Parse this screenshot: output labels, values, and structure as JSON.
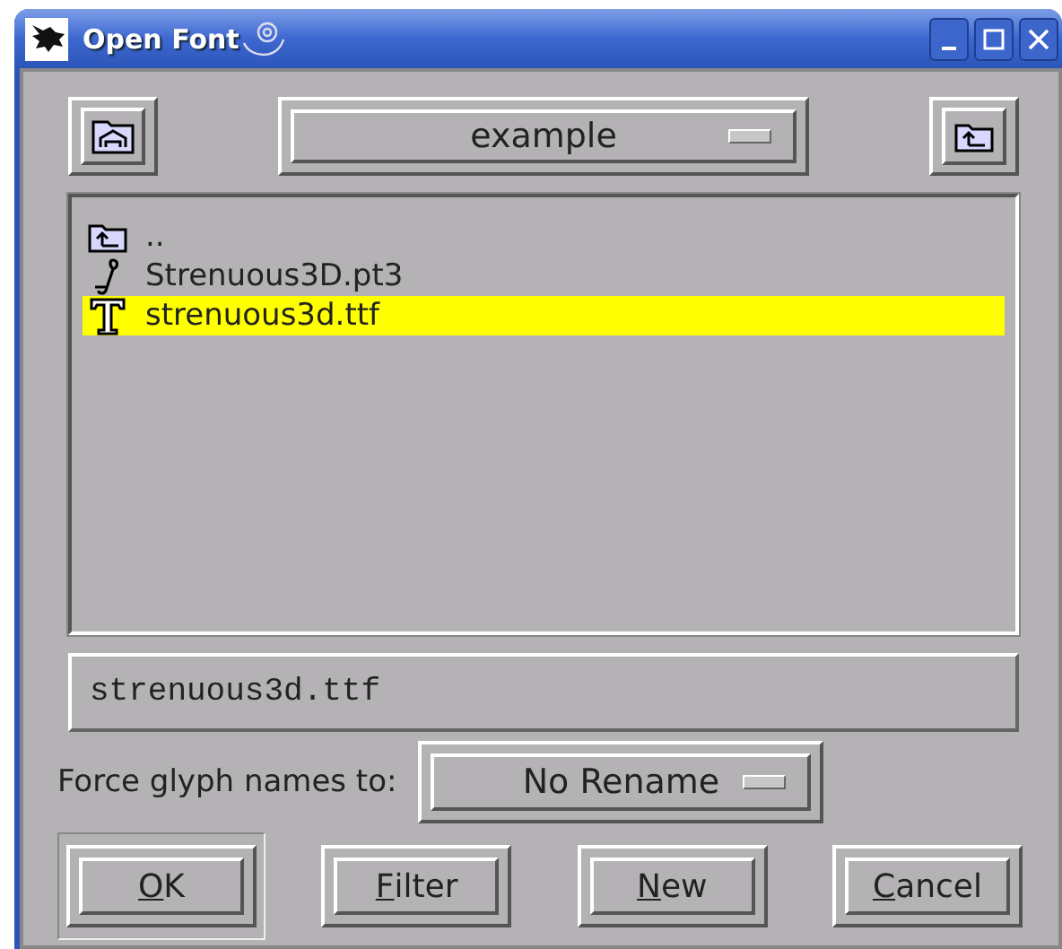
{
  "window": {
    "title": "Open Font"
  },
  "toolbar": {
    "directory": "example"
  },
  "files": [
    {
      "kind": "parent",
      "name": "..",
      "selected": false
    },
    {
      "kind": "pt3",
      "name": "Strenuous3D.pt3",
      "selected": false
    },
    {
      "kind": "ttf",
      "name": "strenuous3d.ttf",
      "selected": true
    }
  ],
  "filename": {
    "value": "strenuous3d.ttf"
  },
  "glyph_names": {
    "label": "Force glyph names to:",
    "value": "No Rename"
  },
  "buttons": [
    {
      "label": "OK",
      "first_letter_underlined": true,
      "default": true
    },
    {
      "label": "Filter",
      "first_letter_underlined": true,
      "default": false
    },
    {
      "label": "New",
      "first_letter_underlined": true,
      "default": false
    },
    {
      "label": "Cancel",
      "first_letter_underlined": true,
      "default": false
    }
  ]
}
